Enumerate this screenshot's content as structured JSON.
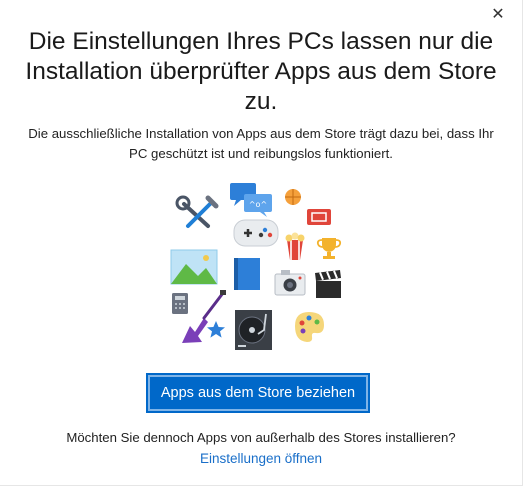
{
  "dialog": {
    "close_glyph": "✕",
    "title": "Die Einstellungen Ihres PCs lassen nur die Installation überprüfter Apps aus dem Store zu.",
    "description": "Die ausschließliche Installation von Apps aus dem Store trägt dazu bei, dass Ihr PC geschützt ist und reibungslos funktioniert.",
    "primary_button": "Apps aus dem Store beziehen",
    "question": "Möchten Sie dennoch Apps von außerhalb des Stores installieren?",
    "settings_link": "Einstellungen öffnen",
    "chat_bubble_text": "^o^"
  },
  "illustration": {
    "icons": [
      "tools-icon",
      "chat-bubbles-icon",
      "basketball-icon",
      "ticket-icon",
      "gamepad-icon",
      "popcorn-icon",
      "trophy-icon",
      "landscape-picture-icon",
      "book-icon",
      "camera-icon",
      "clapperboard-icon",
      "calculator-icon",
      "electric-guitar-icon",
      "star-icon",
      "turntable-icon",
      "paint-palette-icon"
    ]
  },
  "colors": {
    "accent": "#0068c9",
    "link": "#1a6fc9"
  }
}
